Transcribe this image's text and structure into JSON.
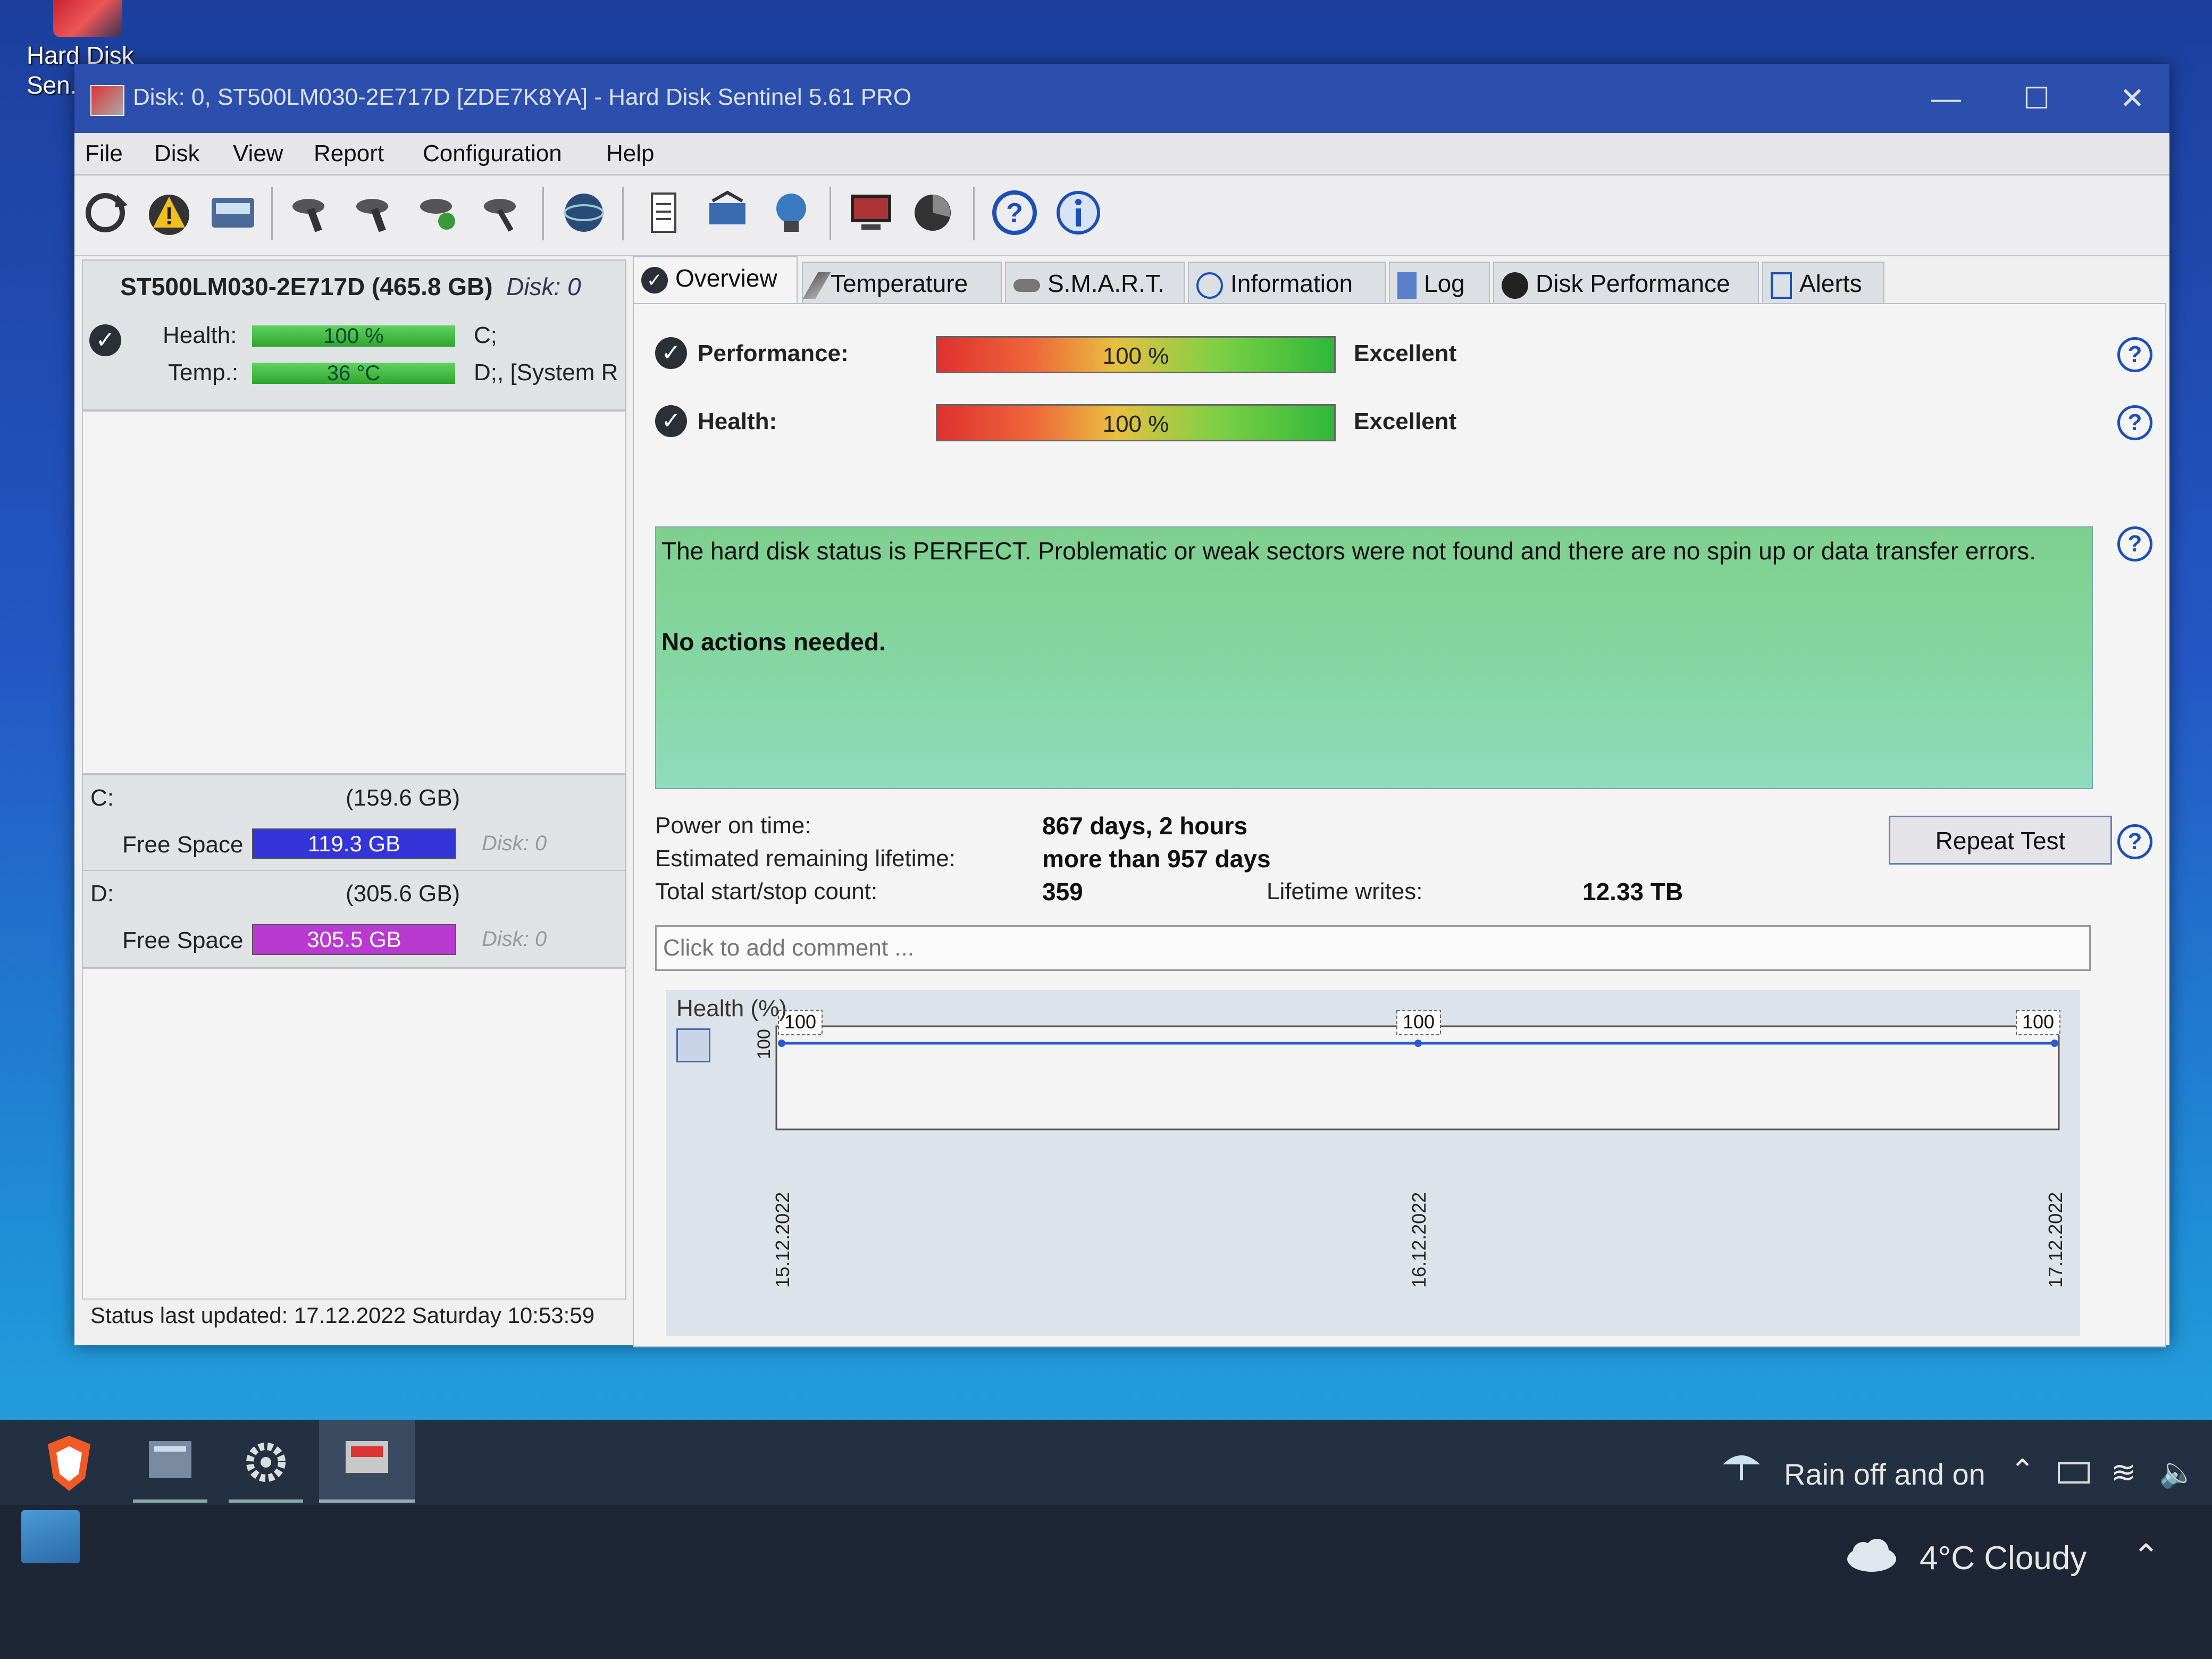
{
  "desktop": {
    "icon_label": "Hard Disk Sen..."
  },
  "window": {
    "title": "Disk: 0, ST500LM030-2E717D [ZDE7K8YA]  -  Hard Disk Sentinel 5.61 PRO"
  },
  "menu": [
    "File",
    "Disk",
    "View",
    "Report",
    "Configuration",
    "Help"
  ],
  "toolbar_icons": [
    "refresh-icon",
    "alert-icon",
    "disk-icon",
    "tool1-icon",
    "tool2-icon",
    "tool3-icon",
    "tool4-icon",
    "globe-icon",
    "document-icon",
    "sync-icon",
    "world-icon",
    "monitor-icon",
    "chart-icon",
    "help-icon",
    "info-icon"
  ],
  "disk": {
    "name": "ST500LM030-2E717D (465.8 GB)",
    "disk_id": "Disk: 0",
    "health_label": "Health:",
    "health_value": "100 %",
    "health_fraction": 1.0,
    "temp_label": "Temp.:",
    "temp_value": "36 °C",
    "health_drive": "C;",
    "temp_drive": "D;,  [System R"
  },
  "volumes": [
    {
      "letter": "C:",
      "size": "(159.6 GB)",
      "free_label": "Free Space",
      "free_value": "119.3 GB",
      "disk": "Disk: 0",
      "color": "#3434d8"
    },
    {
      "letter": "D:",
      "size": "(305.6 GB)",
      "free_label": "Free Space",
      "free_value": "305.5 GB",
      "disk": "Disk: 0",
      "color": "#b83ad0"
    }
  ],
  "status_line": "Status last updated: 17.12.2022 Saturday 10:53:59",
  "tabs": [
    "Overview",
    "Temperature",
    "S.M.A.R.T.",
    "Information",
    "Log",
    "Disk Performance",
    "Alerts"
  ],
  "overview": {
    "performance_label": "Performance:",
    "performance_value": "100 %",
    "performance_rating": "Excellent",
    "health_label": "Health:",
    "health_value": "100 %",
    "health_rating": "Excellent",
    "status_text": "The hard disk status is PERFECT. Problematic or weak sectors were not found and there are no spin up or data transfer errors.",
    "action_text": "No actions needed.",
    "power_on_label": "Power on time:",
    "power_on_value": "867 days, 2 hours",
    "lifetime_label": "Estimated remaining lifetime:",
    "lifetime_value": "more than 957 days",
    "startstop_label": "Total start/stop count:",
    "startstop_value": "359",
    "writes_label": "Lifetime writes:",
    "writes_value": "12.33 TB",
    "repeat_button": "Repeat Test",
    "comment_placeholder": "Click to add comment ..."
  },
  "chart_data": {
    "type": "line",
    "title": "Health (%)",
    "x": [
      "15.12.2022",
      "16.12.2022",
      "17.12.2022"
    ],
    "series": [
      {
        "values": [
          100,
          100,
          100
        ]
      }
    ],
    "point_labels": [
      "100",
      "100",
      "100"
    ],
    "y_tick": "100",
    "ylim": [
      0,
      100
    ]
  },
  "taskbar": {
    "weather_top": "Rain off and on",
    "weather_bottom": "4°C  Cloudy"
  },
  "colors": {
    "titlebar": "#2c4fae",
    "status_green": "#86d7a4",
    "accent": "#1d4fb8"
  }
}
